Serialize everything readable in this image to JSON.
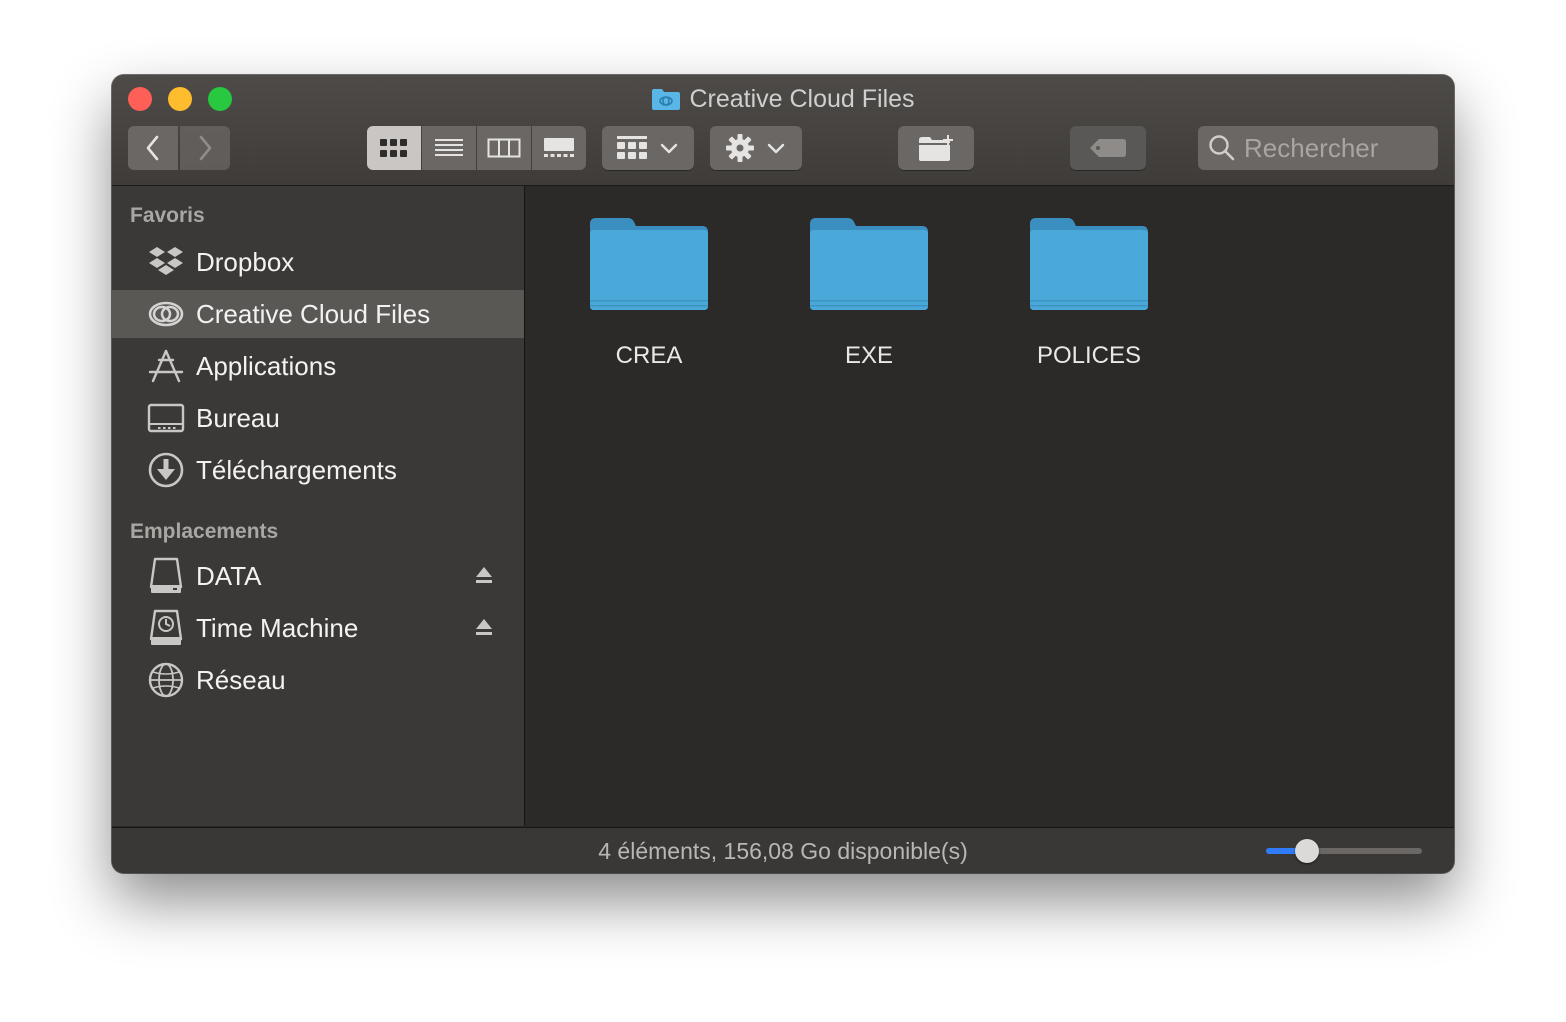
{
  "window": {
    "title": "Creative Cloud Files"
  },
  "toolbar": {
    "search_placeholder": "Rechercher",
    "view_mode": "icons"
  },
  "sidebar": {
    "favorites_title": "Favoris",
    "favorites": [
      {
        "label": "Dropbox",
        "icon": "dropbox-icon"
      },
      {
        "label": "Creative Cloud Files",
        "icon": "creative-cloud-icon",
        "selected": true
      },
      {
        "label": "Applications",
        "icon": "applications-icon"
      },
      {
        "label": "Bureau",
        "icon": "desktop-icon"
      },
      {
        "label": "Téléchargements",
        "icon": "downloads-icon"
      }
    ],
    "locations_title": "Emplacements",
    "locations": [
      {
        "label": "DATA",
        "icon": "disk-icon",
        "ejectable": true
      },
      {
        "label": "Time Machine",
        "icon": "time-machine-icon",
        "ejectable": true
      },
      {
        "label": "Réseau",
        "icon": "network-icon",
        "ejectable": false
      }
    ]
  },
  "content": {
    "folders": [
      {
        "name": "CREA"
      },
      {
        "name": "EXE"
      },
      {
        "name": "POLICES"
      }
    ]
  },
  "status": {
    "text": "4 éléments, 156,08 Go disponible(s)",
    "icon_size_fraction": 0.26
  },
  "colors": {
    "folder": "#4aa9d9",
    "accent": "#2f7cf6",
    "close": "#fe5f57",
    "minimize": "#febc2e",
    "maximize": "#28c840"
  }
}
